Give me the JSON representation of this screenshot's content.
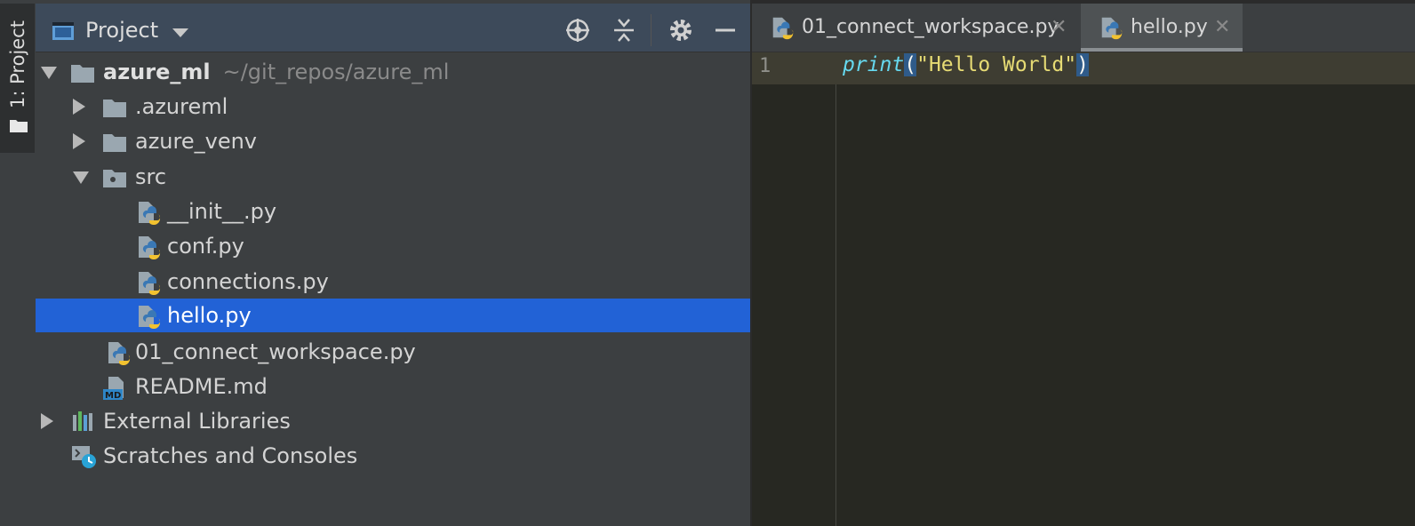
{
  "tool_window_strip": {
    "label": "1: Project"
  },
  "project_panel": {
    "title": "Project",
    "tree": [
      {
        "name": "azure_ml",
        "hint": "~/git_repos/azure_ml",
        "kind": "folder",
        "expanded": true,
        "bold": true
      },
      {
        "name": ".azureml",
        "kind": "folder",
        "expanded": false
      },
      {
        "name": "azure_venv",
        "kind": "folder",
        "expanded": false
      },
      {
        "name": "src",
        "kind": "package-folder",
        "expanded": true
      },
      {
        "name": "__init__.py",
        "kind": "python-file"
      },
      {
        "name": "conf.py",
        "kind": "python-file"
      },
      {
        "name": "connections.py",
        "kind": "python-file"
      },
      {
        "name": "hello.py",
        "kind": "python-file",
        "selected": true
      },
      {
        "name": "01_connect_workspace.py",
        "kind": "python-file"
      },
      {
        "name": "README.md",
        "kind": "markdown-file",
        "icon_text": "MD"
      },
      {
        "name": "External Libraries",
        "kind": "libraries",
        "expanded": false
      },
      {
        "name": "Scratches and Consoles",
        "kind": "scratches"
      }
    ]
  },
  "editor_tabs": [
    {
      "label": "01_connect_workspace.py",
      "active": false
    },
    {
      "label": "hello.py",
      "active": true
    }
  ],
  "editor": {
    "line_numbers": [
      "1"
    ],
    "code_tokens": {
      "fn": "print",
      "open_paren": "(",
      "string": "\"Hello World\"",
      "close_paren": ")"
    }
  },
  "colors": {
    "selection": "#2262d6",
    "editor_bg": "#272822",
    "panel_bg": "#3c3f41",
    "header_bg": "#3d4a5a",
    "python_blue": "#3a78b5",
    "python_yellow": "#f2c230"
  }
}
